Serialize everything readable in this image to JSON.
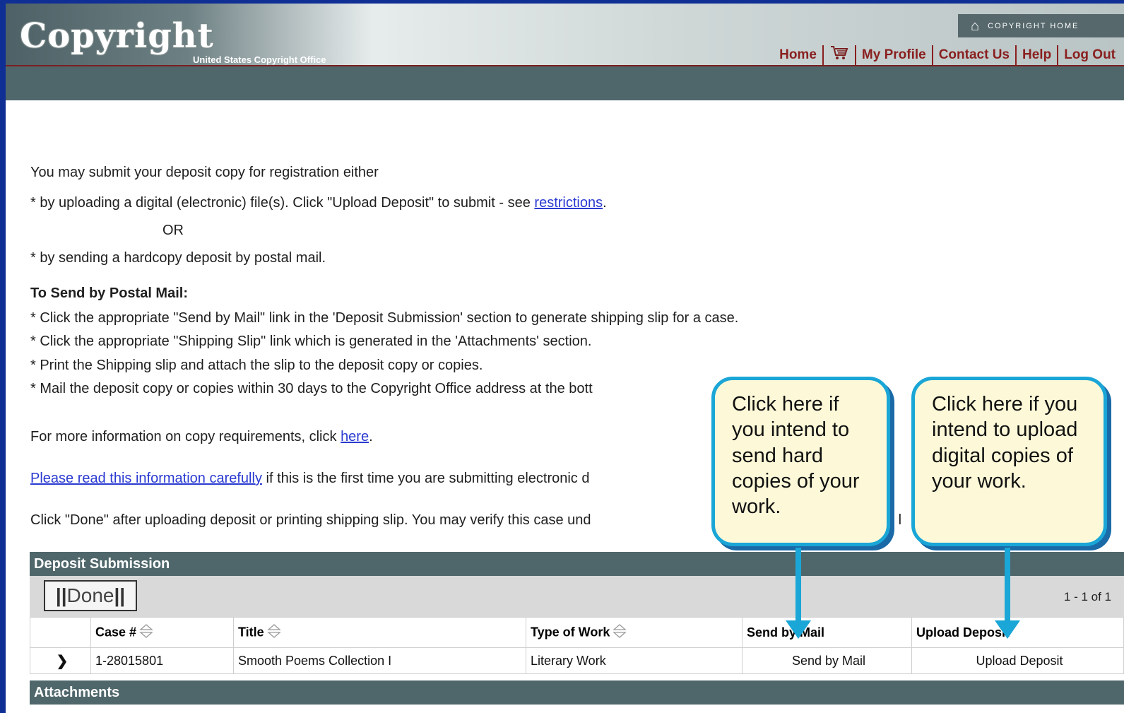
{
  "header": {
    "logo_text": "Copyright",
    "logo_subtitle": "United States Copyright Office",
    "home_badge": "COPYRIGHT HOME",
    "nav": [
      "Home",
      "My Profile",
      "Contact Us",
      "Help",
      "Log Out"
    ]
  },
  "intro": {
    "line1": "You may submit your deposit copy for registration either",
    "line2_prefix": "* by uploading a digital (electronic) file(s). Click \"Upload Deposit\" to submit - see ",
    "line2_link": "restrictions",
    "line2_suffix": ".",
    "or": "OR",
    "line3": "* by sending a hardcopy deposit by postal mail."
  },
  "postal": {
    "heading": "To Send by Postal Mail:",
    "steps": [
      "* Click the appropriate \"Send by Mail\" link in the 'Deposit Submission' section to generate shipping slip for a case.",
      "* Click the appropriate \"Shipping Slip\" link which is generated in the 'Attachments' section.",
      "* Print the Shipping slip and attach the slip to the deposit copy or copies.",
      "* Mail the deposit copy or copies within 30 days to the Copyright Office address at the bott"
    ]
  },
  "more_info": {
    "prefix": "For more information on copy requirements, click ",
    "link": "here",
    "suffix": "."
  },
  "read_info": {
    "link": "Please read this information carefully",
    "suffix": " if this is the first time you are submitting electronic d"
  },
  "done_info": {
    "text": "Click \"Done\" after uploading deposit or printing shipping slip. You may verify this case und",
    "tail": "e l"
  },
  "deposit_submission": {
    "title": "Deposit Submission",
    "done_label": "Done",
    "paging": "1 - 1 of 1",
    "columns": [
      "Case #",
      "Title",
      "Type of Work",
      "Send by Mail",
      "Upload Deposit"
    ],
    "rows": [
      {
        "case": "1-28015801",
        "title": "Smooth Poems Collection I",
        "type": "Literary Work",
        "send": "Send by Mail",
        "upload": "Upload Deposit"
      }
    ]
  },
  "attachments": {
    "title": "Attachments"
  },
  "callouts": {
    "mail": "Click here if you intend to send hard copies of your work.",
    "upload": "Click here if you intend to upload digital copies of your work."
  },
  "colors": {
    "outer": "#0f2f95",
    "band": "#4f676b",
    "nav_text": "#8a1f1f",
    "callout_border": "#1aa6d6",
    "callout_fill": "#fdf9d8",
    "link": "#2a3ad1"
  },
  "icons": [
    "house-icon",
    "cart-icon",
    "sort-icon",
    "row-arrow-icon"
  ]
}
